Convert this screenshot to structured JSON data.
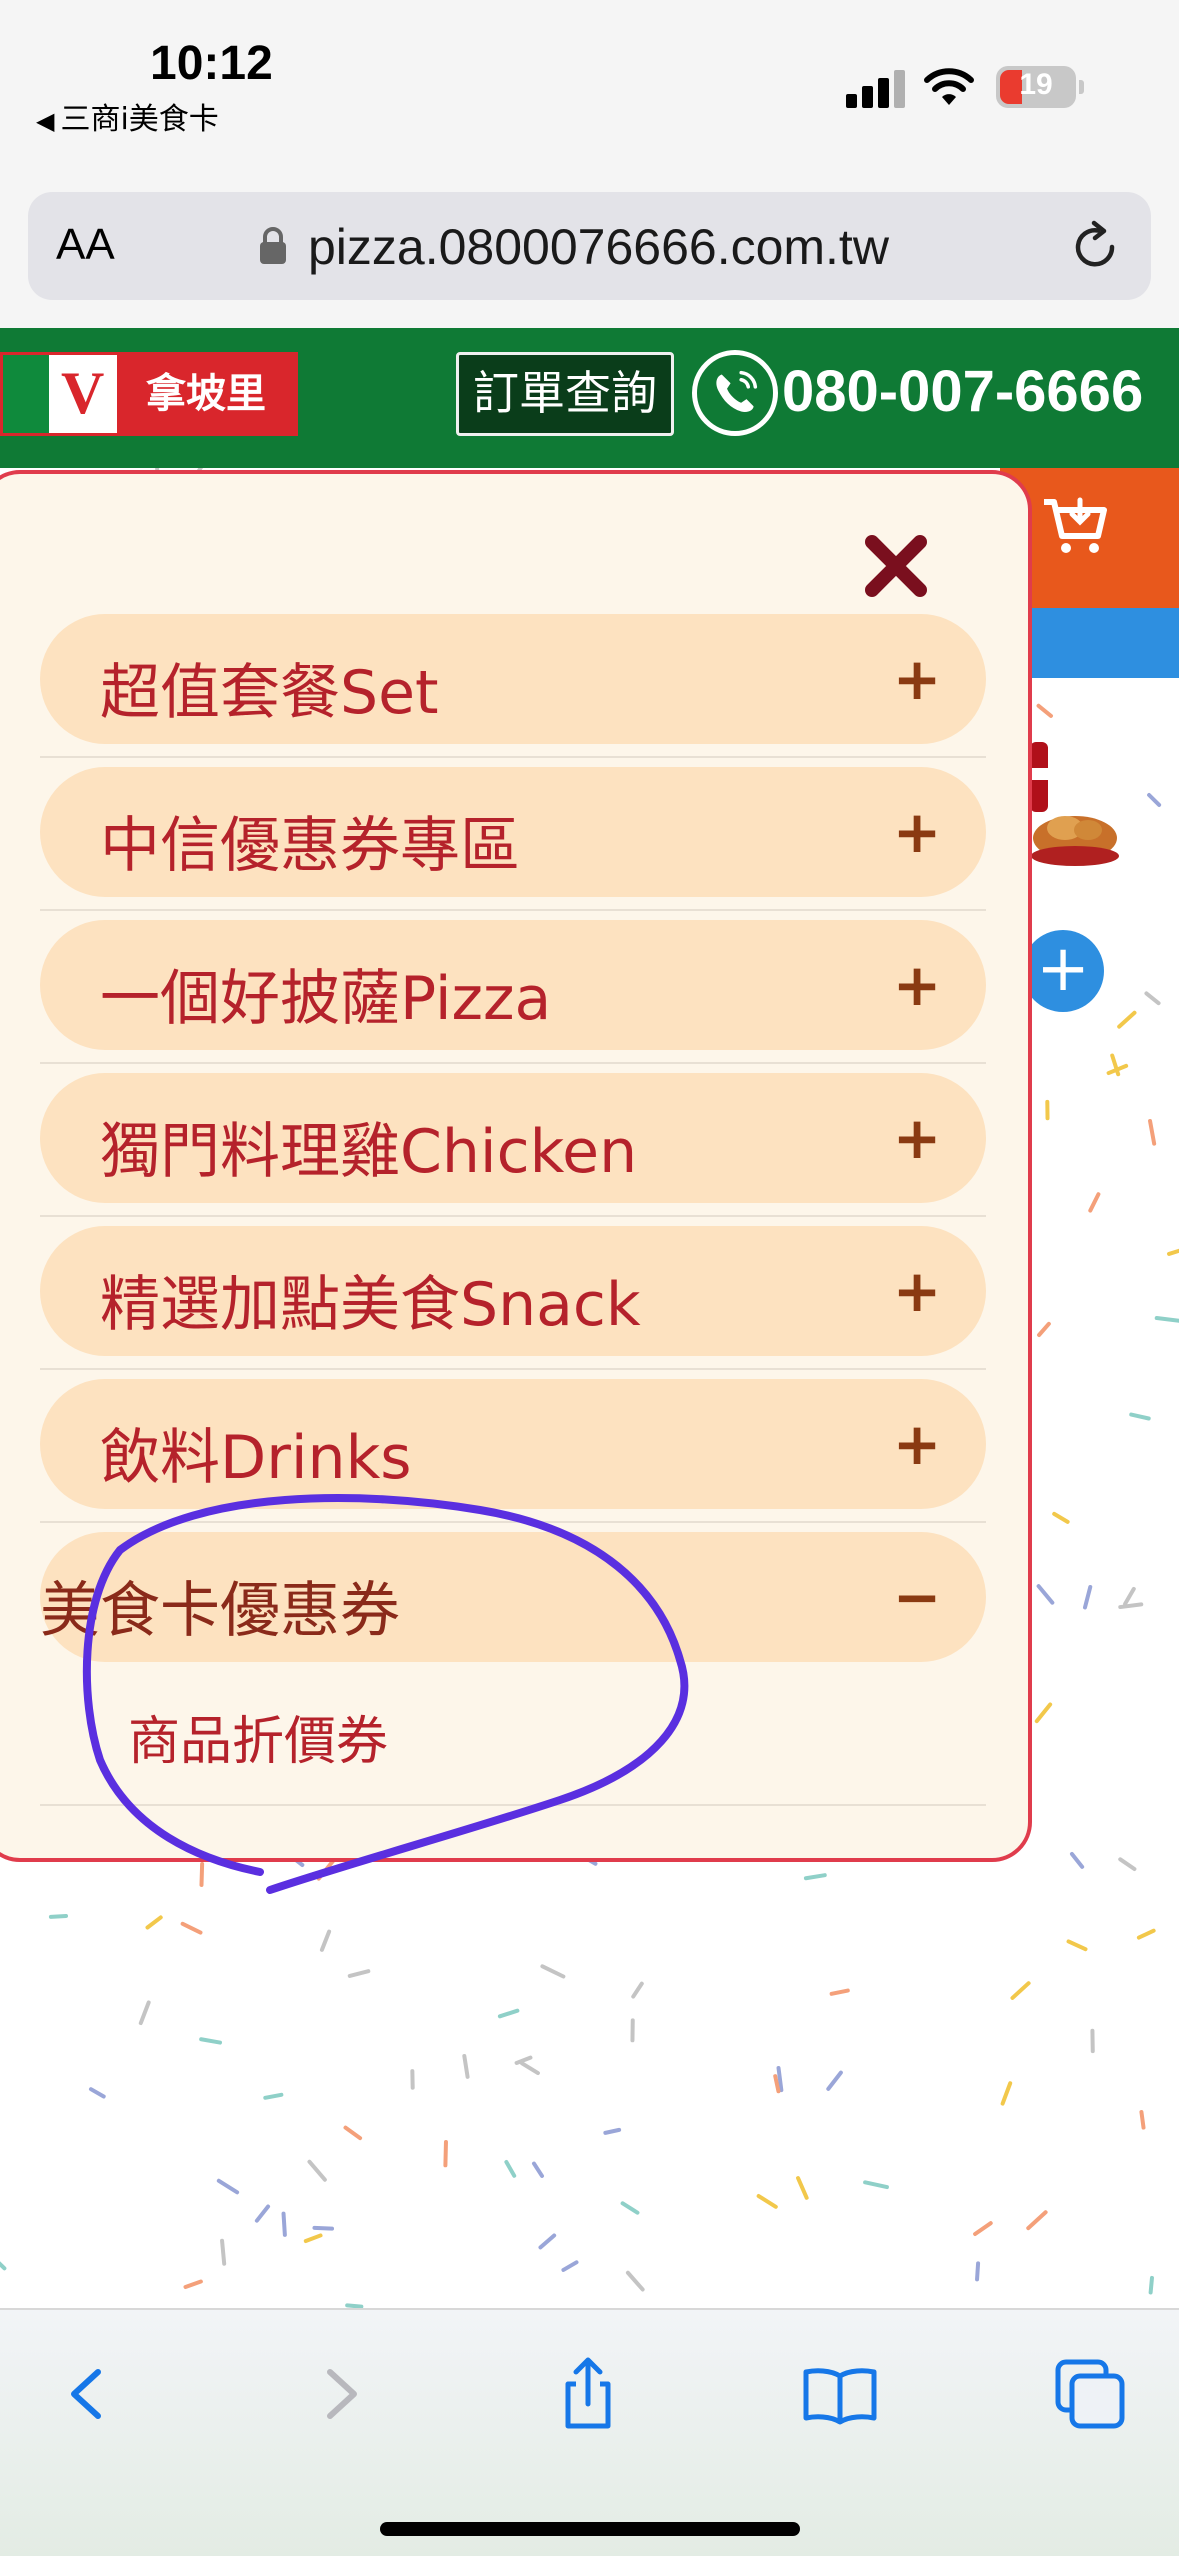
{
  "status_bar": {
    "time": "10:12",
    "back_app": "三商i美食卡",
    "battery_level": "19"
  },
  "browser": {
    "text_size_button": "AA",
    "url": "pizza.0800076666.com.tw"
  },
  "header": {
    "logo_text": "拿坡里",
    "order_query_button": "訂單查詢",
    "phone_number": "080-007-6666"
  },
  "menu": {
    "items": [
      {
        "label": "超值套餐Set",
        "toggle": "+"
      },
      {
        "label": "中信優惠券專區",
        "toggle": "+"
      },
      {
        "label": "一個好披薩Pizza",
        "toggle": "+"
      },
      {
        "label": "獨門料理雞Chicken",
        "toggle": "+"
      },
      {
        "label": "精選加點美食Snack",
        "toggle": "+"
      },
      {
        "label": "飲料Drinks",
        "toggle": "+"
      },
      {
        "label": "美食卡優惠券",
        "toggle": "−",
        "subitems": [
          {
            "label": "商品折價券"
          }
        ]
      }
    ]
  },
  "page": {
    "add_button": "+"
  },
  "colors": {
    "header_green": "#0f7a35",
    "menu_item_bg": "#fde2c0",
    "menu_text_red": "#b5222b",
    "panel_border": "#e03c4c",
    "annotation_purple": "#5a2fe0",
    "safari_blue": "#1677e8"
  }
}
